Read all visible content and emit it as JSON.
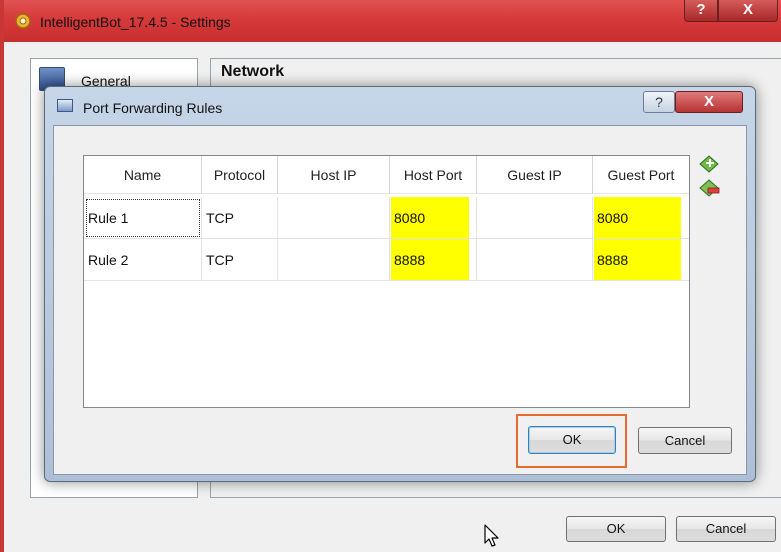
{
  "window": {
    "title": "IntelligentBot_17.4.5 - Settings",
    "help_label": "?",
    "close_label": "X"
  },
  "sidebar": {
    "general_label": "General"
  },
  "panel": {
    "title": "Network"
  },
  "outer_buttons": {
    "ok_label": "OK",
    "cancel_label": "Cancel"
  },
  "dialog": {
    "title": "Port Forwarding Rules",
    "help_label": "?",
    "close_label": "X",
    "ok_label": "OK",
    "cancel_label": "Cancel"
  },
  "table": {
    "columns": [
      "Name",
      "Protocol",
      "Host IP",
      "Host Port",
      "Guest IP",
      "Guest Port"
    ],
    "rows": [
      [
        "Rule 1",
        "TCP",
        "",
        "8080",
        "",
        "8080"
      ],
      [
        "Rule 2",
        "TCP",
        "",
        "8888",
        "",
        "8888"
      ]
    ]
  },
  "colors": {
    "highlight": "#ffff00",
    "ok_highlight_border": "#e76a2e",
    "titlebar": "#d63a3a"
  },
  "icons": {
    "window": "settings-gear-icon",
    "dialog": "window-icon",
    "add": "add-rule-icon",
    "remove": "remove-rule-icon",
    "cursor": "mouse-cursor-icon"
  }
}
